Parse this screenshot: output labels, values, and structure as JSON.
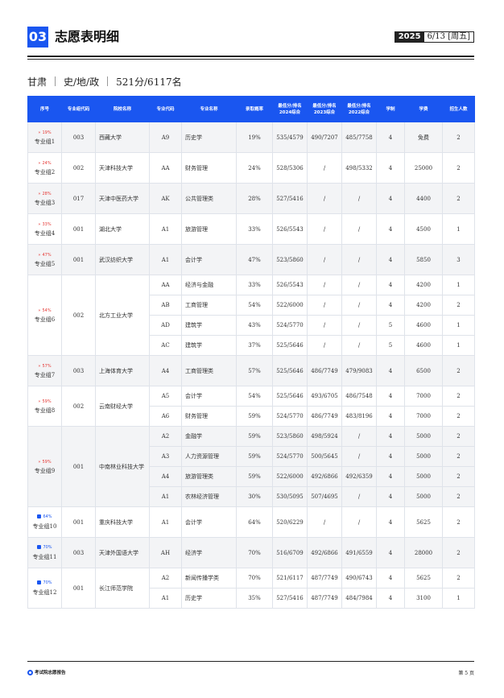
{
  "header": {
    "section_number": "03",
    "title": "志愿表明细",
    "date_year": "2025",
    "date_rest": "6/13 [周五]"
  },
  "info": {
    "province": "甘肃",
    "subjects": "史/地/政",
    "score_rank": "521分/6117名"
  },
  "columns": [
    "序号",
    "专业组代码",
    "院校名称",
    "专业代码",
    "专业名称",
    "录取概率",
    "最低分/排名 2024综合",
    "最低分/排名 2023综合",
    "最低分/排名 2022综合",
    "学制",
    "学费",
    "招生人数"
  ],
  "groups": [
    {
      "badge": "19%",
      "badge_color": "red",
      "label": "专业组1",
      "code": "003",
      "school": "西藏大学",
      "shade": true,
      "majors": [
        {
          "code": "A9",
          "name": "历史学",
          "prob": "19%",
          "y2024": "535/4579",
          "y2023": "490/7207",
          "y2022": "485/7758",
          "years": "4",
          "fee": "免费",
          "num": "2"
        }
      ]
    },
    {
      "badge": "24%",
      "badge_color": "red",
      "label": "专业组2",
      "code": "002",
      "school": "天津科技大学",
      "shade": false,
      "majors": [
        {
          "code": "AA",
          "name": "财务管理",
          "prob": "24%",
          "y2024": "528/5306",
          "y2023": "/",
          "y2022": "498/5332",
          "years": "4",
          "fee": "25000",
          "num": "2"
        }
      ]
    },
    {
      "badge": "28%",
      "badge_color": "red",
      "label": "专业组3",
      "code": "017",
      "school": "天津中医药大学",
      "shade": true,
      "majors": [
        {
          "code": "AK",
          "name": "公共管理类",
          "prob": "28%",
          "y2024": "527/5416",
          "y2023": "/",
          "y2022": "/",
          "years": "4",
          "fee": "4400",
          "num": "2"
        }
      ]
    },
    {
      "badge": "33%",
      "badge_color": "red",
      "label": "专业组4",
      "code": "001",
      "school": "湖北大学",
      "shade": false,
      "majors": [
        {
          "code": "A1",
          "name": "旅游管理",
          "prob": "33%",
          "y2024": "526/5543",
          "y2023": "/",
          "y2022": "/",
          "years": "4",
          "fee": "4500",
          "num": "1"
        }
      ]
    },
    {
      "badge": "47%",
      "badge_color": "red",
      "label": "专业组5",
      "code": "001",
      "school": "武汉纺织大学",
      "shade": true,
      "majors": [
        {
          "code": "A1",
          "name": "会计学",
          "prob": "47%",
          "y2024": "523/5860",
          "y2023": "/",
          "y2022": "/",
          "years": "4",
          "fee": "5850",
          "num": "3"
        }
      ]
    },
    {
      "badge": "54%",
      "badge_color": "red",
      "label": "专业组6",
      "code": "002",
      "school": "北方工业大学",
      "shade": false,
      "majors": [
        {
          "code": "AA",
          "name": "经济与金融",
          "prob": "33%",
          "y2024": "526/5543",
          "y2023": "/",
          "y2022": "/",
          "years": "4",
          "fee": "4200",
          "num": "1"
        },
        {
          "code": "AB",
          "name": "工商管理",
          "prob": "54%",
          "y2024": "522/6000",
          "y2023": "/",
          "y2022": "/",
          "years": "4",
          "fee": "4200",
          "num": "2"
        },
        {
          "code": "AD",
          "name": "建筑学",
          "prob": "43%",
          "y2024": "524/5770",
          "y2023": "/",
          "y2022": "/",
          "years": "5",
          "fee": "4600",
          "num": "1"
        },
        {
          "code": "AC",
          "name": "建筑学",
          "prob": "37%",
          "y2024": "525/5646",
          "y2023": "/",
          "y2022": "/",
          "years": "5",
          "fee": "4600",
          "num": "1"
        }
      ]
    },
    {
      "badge": "57%",
      "badge_color": "red",
      "label": "专业组7",
      "code": "003",
      "school": "上海体育大学",
      "shade": true,
      "majors": [
        {
          "code": "A4",
          "name": "工商管理类",
          "prob": "57%",
          "y2024": "525/5646",
          "y2023": "486/7749",
          "y2022": "479/9083",
          "years": "4",
          "fee": "6500",
          "num": "2"
        }
      ]
    },
    {
      "badge": "59%",
      "badge_color": "red",
      "label": "专业组8",
      "code": "002",
      "school": "云南财经大学",
      "shade": false,
      "majors": [
        {
          "code": "A5",
          "name": "会计学",
          "prob": "54%",
          "y2024": "525/5646",
          "y2023": "493/6705",
          "y2022": "486/7548",
          "years": "4",
          "fee": "7000",
          "num": "2"
        },
        {
          "code": "A6",
          "name": "财务管理",
          "prob": "59%",
          "y2024": "524/5770",
          "y2023": "486/7749",
          "y2022": "483/8196",
          "years": "4",
          "fee": "7000",
          "num": "2"
        }
      ]
    },
    {
      "badge": "59%",
      "badge_color": "red",
      "label": "专业组9",
      "code": "001",
      "school": "中南林业科技大学",
      "shade": true,
      "majors": [
        {
          "code": "A2",
          "name": "金融学",
          "prob": "59%",
          "y2024": "523/5860",
          "y2023": "498/5924",
          "y2022": "/",
          "years": "4",
          "fee": "5000",
          "num": "2"
        },
        {
          "code": "A3",
          "name": "人力资源管理",
          "prob": "59%",
          "y2024": "524/5770",
          "y2023": "500/5645",
          "y2022": "/",
          "years": "4",
          "fee": "5000",
          "num": "2"
        },
        {
          "code": "A4",
          "name": "旅游管理类",
          "prob": "59%",
          "y2024": "522/6000",
          "y2023": "492/6866",
          "y2022": "492/6359",
          "years": "4",
          "fee": "5000",
          "num": "2"
        },
        {
          "code": "A1",
          "name": "农林经济管理",
          "prob": "30%",
          "y2024": "530/5095",
          "y2023": "507/4695",
          "y2022": "/",
          "years": "4",
          "fee": "5000",
          "num": "2"
        }
      ]
    },
    {
      "badge": "64%",
      "badge_color": "blue",
      "label": "专业组10",
      "code": "001",
      "school": "重庆科技大学",
      "shade": false,
      "majors": [
        {
          "code": "A1",
          "name": "会计学",
          "prob": "64%",
          "y2024": "520/6229",
          "y2023": "/",
          "y2022": "/",
          "years": "4",
          "fee": "5625",
          "num": "2"
        }
      ]
    },
    {
      "badge": "70%",
      "badge_color": "blue",
      "label": "专业组11",
      "code": "003",
      "school": "天津外国语大学",
      "shade": true,
      "majors": [
        {
          "code": "AH",
          "name": "经济学",
          "prob": "70%",
          "y2024": "516/6709",
          "y2023": "492/6866",
          "y2022": "491/6559",
          "years": "4",
          "fee": "28000",
          "num": "2"
        }
      ]
    },
    {
      "badge": "70%",
      "badge_color": "blue",
      "label": "专业组12",
      "code": "001",
      "school": "长江师范学院",
      "shade": false,
      "majors": [
        {
          "code": "A2",
          "name": "新闻传播学类",
          "prob": "70%",
          "y2024": "521/6117",
          "y2023": "487/7749",
          "y2022": "490/6743",
          "years": "4",
          "fee": "5625",
          "num": "2"
        },
        {
          "code": "A1",
          "name": "历史学",
          "prob": "35%",
          "y2024": "527/5416",
          "y2023": "487/7749",
          "y2022": "484/7984",
          "years": "4",
          "fee": "3100",
          "num": "1"
        }
      ]
    }
  ],
  "footer": {
    "brand": "考试院志愿报告",
    "page": "第 5 页"
  }
}
